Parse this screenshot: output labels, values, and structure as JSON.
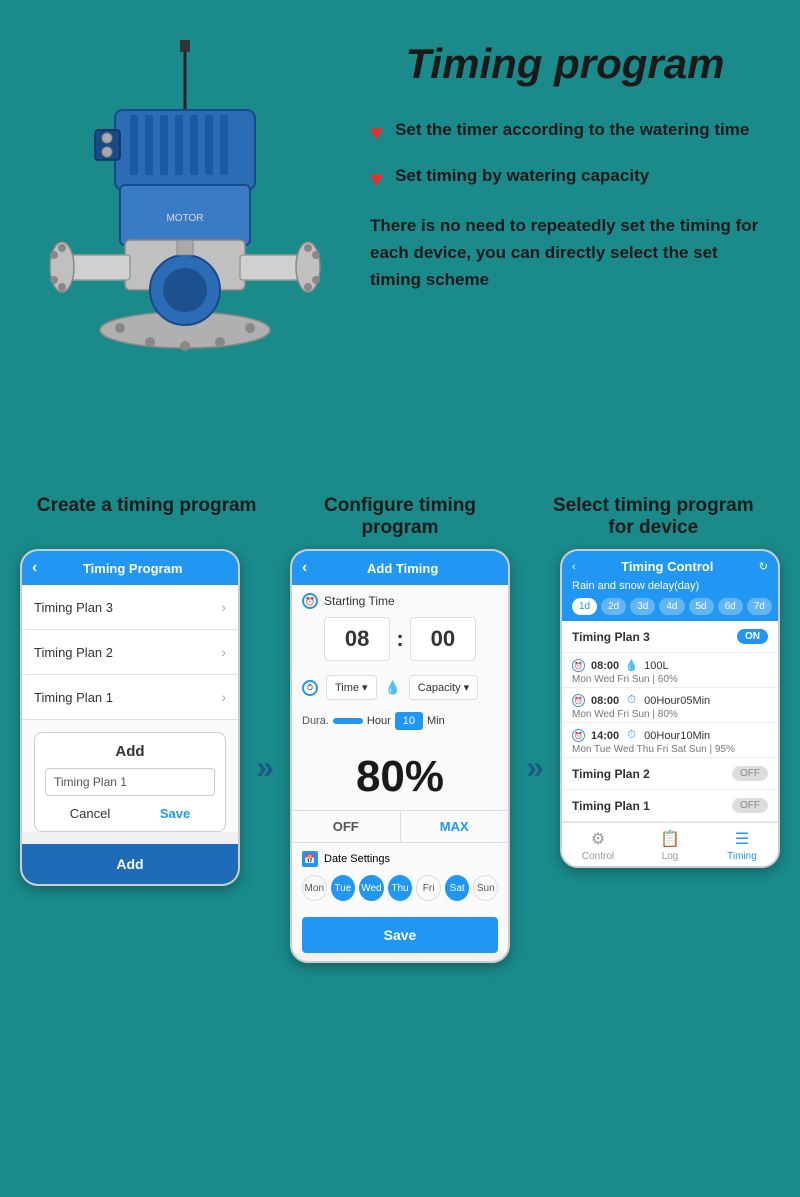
{
  "page": {
    "title": "Timing program",
    "bg_color": "#1a8a8a"
  },
  "header": {
    "bullet1": "Set the timer according to the watering time",
    "bullet2": "Set timing by watering capacity",
    "description": "There is no need to repeatedly set the timing for each device, you can directly select the set timing scheme"
  },
  "steps": [
    {
      "title": "Create a timing program",
      "phone": {
        "header": "Timing Program",
        "items": [
          "Timing Plan 3",
          "Timing Plan 2",
          "Timing Plan 1"
        ],
        "dialog_title": "Add",
        "dialog_input": "Timing Plan 1",
        "cancel_label": "Cancel",
        "save_label": "Save",
        "add_button": "Add"
      }
    },
    {
      "title": "Configure timing program",
      "phone": {
        "header": "Add Timing",
        "starting_time_label": "Starting Time",
        "hour": "08",
        "minute": "00",
        "time_label": "Time",
        "capacity_label": "Capacity",
        "dura_label": "Dura.",
        "hour_label": "Hour",
        "dura_value": "10",
        "min_label": "Min",
        "percent": "80%",
        "off_label": "OFF",
        "max_label": "MAX",
        "date_settings_label": "Date Settings",
        "days": [
          "Mon",
          "Tue",
          "Wed",
          "Thu",
          "Fri",
          "Sat",
          "Sun"
        ],
        "active_days": [
          1,
          2,
          3,
          5
        ],
        "save_label": "Save"
      }
    },
    {
      "title": "Select timing program for device",
      "phone": {
        "header": "Timing Control",
        "delay_label": "Rain and snow delay(day)",
        "day_pills": [
          "1d",
          "2d",
          "3d",
          "4d",
          "5d",
          "6d",
          "7d"
        ],
        "selected_pill": 0,
        "plan3": {
          "label": "Timing Plan 3",
          "toggle": "ON",
          "schedules": [
            {
              "time": "08:00",
              "capacity": "100L",
              "days": "Mon  Wed  Fri  Sun | 60%"
            },
            {
              "time": "08:00",
              "capacity": "00Hour05Min",
              "days": "Mon  Wed  Fri  Sun | 80%"
            },
            {
              "time": "14:00",
              "capacity": "00Hour10Min",
              "days": "Mon Tue Wed Thu Fri Sat Sun | 95%"
            }
          ]
        },
        "plan2": {
          "label": "Timing Plan 2",
          "toggle": "OFF"
        },
        "plan1": {
          "label": "Timing Plan 1",
          "toggle": "OFF"
        },
        "footer": [
          "Control",
          "Log",
          "Timing"
        ],
        "active_footer": 2
      }
    }
  ],
  "arrows": [
    "»",
    "»"
  ],
  "icons": {
    "back_arrow": "‹",
    "chevron_right": "›",
    "heart": "♥",
    "refresh": "↻"
  }
}
